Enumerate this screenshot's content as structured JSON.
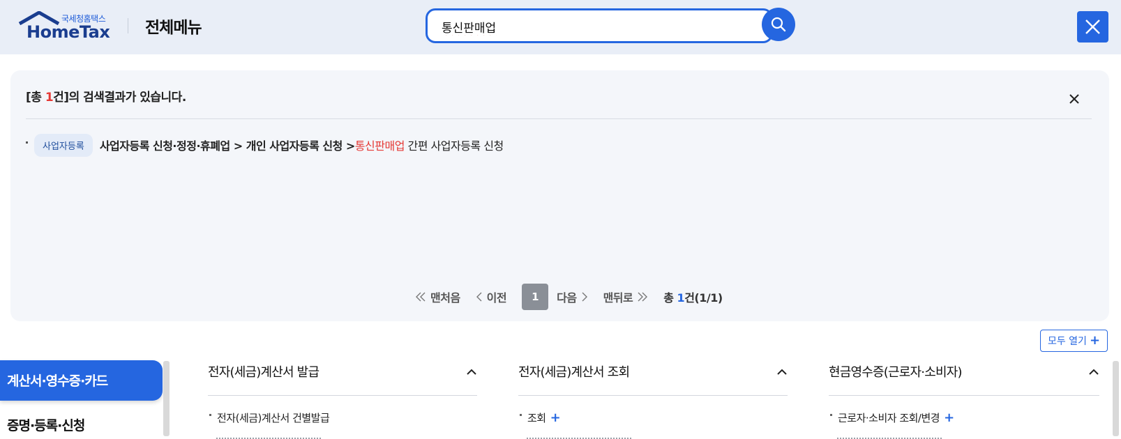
{
  "header": {
    "logo_korean": "국세청홈택스",
    "logo_english": "HomeTax",
    "menu_title": "전체메뉴",
    "search_value": "통신판매업"
  },
  "results": {
    "summary_prefix": "[총 ",
    "summary_count": "1",
    "summary_suffix": "건]의 검색결과가 있습니다.",
    "items": [
      {
        "tag": "사업자등록",
        "path_before": "사업자등록 신청·정정·휴폐업 > 개인 사업자등록 신청 >",
        "highlight": "통신판매업",
        "path_after": " 간편 사업자등록 신청"
      }
    ],
    "pager": {
      "first": "맨처음",
      "prev": "이전",
      "current": "1",
      "next": "다음",
      "last": "맨뒤로",
      "total_prefix": "총 ",
      "total_count": "1",
      "total_suffix": "건(1/1)"
    }
  },
  "expand_all_label": "모두 열기",
  "categories": [
    {
      "label": "계산서·영수증·카드",
      "active": true
    },
    {
      "label": "증명·등록·신청",
      "active": false
    }
  ],
  "columns": [
    {
      "title": "전자(세금)계산서 발급",
      "first_item": "전자(세금)계산서 건별발급",
      "has_plus": false
    },
    {
      "title": "전자(세금)계산서 조회",
      "first_item": "조회",
      "has_plus": true
    },
    {
      "title": "현금영수증(근로자·소비자)",
      "first_item": "근로자·소비자 조회/변경",
      "has_plus": true
    }
  ],
  "colors": {
    "accent": "#2566e0",
    "header_bg": "#e9eef7",
    "highlight": "#e53935",
    "panel_bg": "#f4f6fa"
  }
}
